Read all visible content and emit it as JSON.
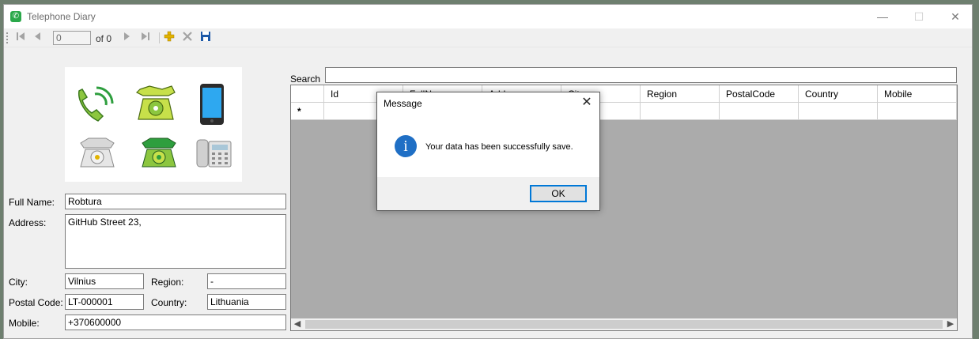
{
  "window": {
    "title": "Telephone Diary",
    "minimize_glyph": "—",
    "maximize_glyph": "☐",
    "close_glyph": "✕"
  },
  "toolbar": {
    "position_value": "0",
    "of_label": "of 0",
    "icons": [
      "move-first-icon",
      "move-previous-icon",
      "move-next-icon",
      "move-last-icon",
      "add-new-icon",
      "delete-icon",
      "save-icon"
    ]
  },
  "form": {
    "full_name": {
      "label": "Full Name:",
      "value": "Robtura"
    },
    "address": {
      "label": "Address:",
      "value": "GitHub Street 23,"
    },
    "city": {
      "label": "City:",
      "value": "Vilnius"
    },
    "region": {
      "label": "Region:",
      "value": "-"
    },
    "postal_code": {
      "label": "Postal Code:",
      "value": "LT-000001"
    },
    "country": {
      "label": "Country:",
      "value": "Lithuania"
    },
    "mobile": {
      "label": "Mobile:",
      "value": "+370600000"
    }
  },
  "search": {
    "label": "Search",
    "value": ""
  },
  "grid": {
    "columns": [
      "Id",
      "FullName",
      "Address",
      "City",
      "Region",
      "PostalCode",
      "Country",
      "Mobile"
    ],
    "new_row_marker": "*"
  },
  "dialog": {
    "title": "Message",
    "message": "Your data has been successfully save.",
    "ok_label": "OK",
    "close_glyph": "✕",
    "icon": "info-icon"
  },
  "colors": {
    "accent": "#0078d7",
    "info_icon": "#1f6fc5",
    "grid_background": "#ababab",
    "phone_green": "#8cc63f"
  }
}
